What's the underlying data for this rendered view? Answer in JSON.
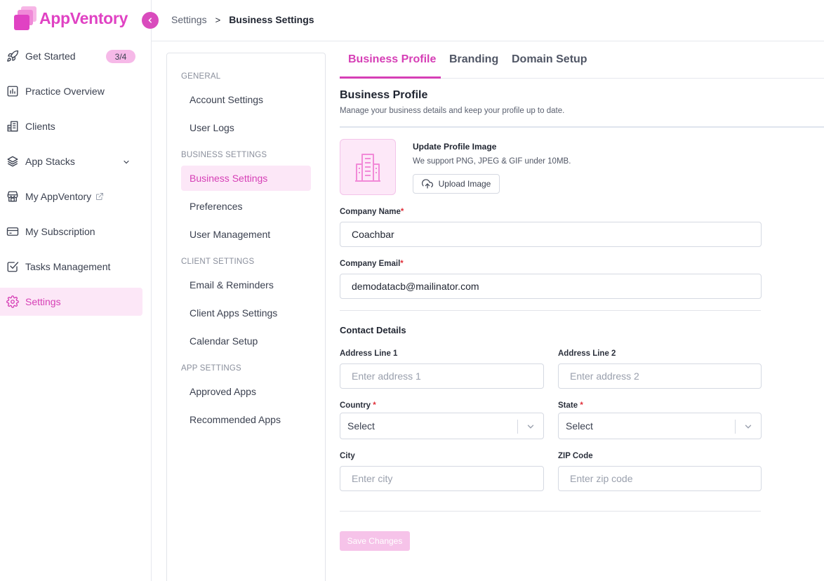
{
  "app": {
    "name": "AppVentory"
  },
  "colors": {
    "accent": "#d63fb6",
    "accent_light": "#fce7f7",
    "border": "#d5d9e2"
  },
  "sidebar": {
    "items": [
      {
        "label": "Get Started",
        "icon": "rocket-icon",
        "badge": "3/4"
      },
      {
        "label": "Practice Overview",
        "icon": "chart-icon"
      },
      {
        "label": "Clients",
        "icon": "building-icon"
      },
      {
        "label": "App Stacks",
        "icon": "layers-icon"
      },
      {
        "label": "My AppVentory",
        "icon": "store-icon"
      },
      {
        "label": "My Subscription",
        "icon": "card-icon"
      },
      {
        "label": "Tasks Management",
        "icon": "checkbox-icon"
      },
      {
        "label": "Settings",
        "icon": "gear-icon",
        "active": true
      }
    ]
  },
  "breadcrumb": {
    "parent": "Settings",
    "separator": ">",
    "current": "Business Settings"
  },
  "submenu": {
    "groups": [
      {
        "title": "GENERAL",
        "items": [
          "Account Settings",
          "User Logs"
        ]
      },
      {
        "title": "BUSINESS SETTINGS",
        "items": [
          "Business Settings",
          "Preferences",
          "User Management"
        ]
      },
      {
        "title": "CLIENT SETTINGS",
        "items": [
          "Email & Reminders",
          "Client Apps Settings",
          "Calendar Setup"
        ]
      },
      {
        "title": "APP SETTINGS",
        "items": [
          "Approved Apps",
          "Recommended Apps"
        ]
      }
    ],
    "active": "Business Settings"
  },
  "tabs": [
    {
      "label": "Business Profile",
      "active": true
    },
    {
      "label": "Branding"
    },
    {
      "label": "Domain Setup"
    }
  ],
  "profile": {
    "title": "Business Profile",
    "description": "Manage your business details and keep your profile up to date.",
    "image_title": "Update Profile Image",
    "image_desc": "We support PNG, JPEG & GIF under 10MB.",
    "upload_label": "Upload Image"
  },
  "form": {
    "company_name": {
      "label": "Company Name",
      "required": "*",
      "value": "Coachbar"
    },
    "company_email": {
      "label": "Company Email",
      "required": "*",
      "value": "demodatacb@mailinator.com"
    },
    "contact_title": "Contact Details",
    "address1": {
      "label": "Address Line 1",
      "placeholder": "Enter address 1"
    },
    "address2": {
      "label": "Address Line 2",
      "placeholder": "Enter address 2"
    },
    "country": {
      "label": "Country",
      "required": "*",
      "value": "Select"
    },
    "state": {
      "label": "State",
      "required": "*",
      "value": "Select"
    },
    "city": {
      "label": "City",
      "placeholder": "Enter city"
    },
    "zip": {
      "label": "ZIP Code",
      "placeholder": "Enter zip code"
    },
    "save_label": "Save Changes"
  }
}
